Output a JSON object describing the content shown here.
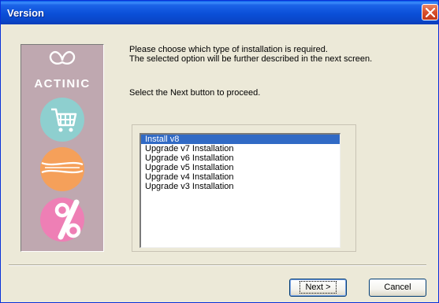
{
  "window": {
    "title": "Version"
  },
  "logo": {
    "brand_text": "ACTINIC"
  },
  "instructions": {
    "line1": "Please choose which type of installation is required.",
    "line2": "The selected option will be further described in the next screen.",
    "line3": "Select the Next button to proceed."
  },
  "install_options": [
    {
      "label": "Install v8",
      "selected": true
    },
    {
      "label": "Upgrade v7 Installation",
      "selected": false
    },
    {
      "label": "Upgrade v6 Installation",
      "selected": false
    },
    {
      "label": "Upgrade v5 Installation",
      "selected": false
    },
    {
      "label": "Upgrade v4 Installation",
      "selected": false
    },
    {
      "label": "Upgrade v3 Installation",
      "selected": false
    }
  ],
  "buttons": {
    "next": "Next >",
    "cancel": "Cancel"
  },
  "colors": {
    "title_bar": "#0a4fd8",
    "selection": "#316ac5",
    "panel": "#bfa8b0",
    "teal": "#8ecfcf",
    "orange": "#f5a05a",
    "pink": "#ee7fb5"
  }
}
